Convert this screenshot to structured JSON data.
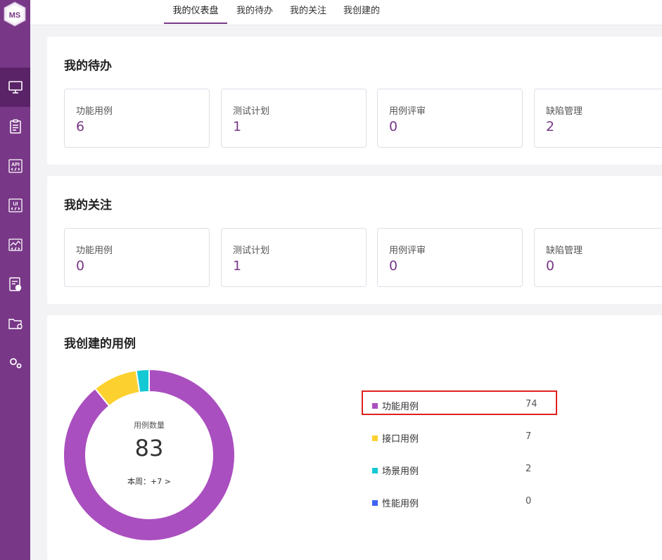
{
  "app": {
    "logo_text": "MS"
  },
  "tabs": [
    {
      "label": "我的仪表盘",
      "active": true
    },
    {
      "label": "我的待办",
      "active": false
    },
    {
      "label": "我的关注",
      "active": false
    },
    {
      "label": "我创建的",
      "active": false
    }
  ],
  "sidebar": {
    "items": [
      {
        "icon": "monitor-icon",
        "active": true
      },
      {
        "icon": "clipboard-icon",
        "active": false
      },
      {
        "icon": "api-icon",
        "text": "API",
        "active": false
      },
      {
        "icon": "ui-icon",
        "text": "UI",
        "active": false
      },
      {
        "icon": "performance-icon",
        "active": false
      },
      {
        "icon": "report-icon",
        "active": false
      },
      {
        "icon": "folder-settings-icon",
        "active": false
      },
      {
        "icon": "gears-icon",
        "active": false
      }
    ]
  },
  "todo": {
    "title": "我的待办",
    "stats": [
      {
        "label": "功能用例",
        "value": "6"
      },
      {
        "label": "测试计划",
        "value": "1"
      },
      {
        "label": "用例评审",
        "value": "0"
      },
      {
        "label": "缺陷管理",
        "value": "2"
      }
    ]
  },
  "follow": {
    "title": "我的关注",
    "stats": [
      {
        "label": "功能用例",
        "value": "0"
      },
      {
        "label": "测试计划",
        "value": "1"
      },
      {
        "label": "用例评审",
        "value": "0"
      },
      {
        "label": "缺陷管理",
        "value": "0"
      }
    ]
  },
  "created": {
    "title": "我创建的用例",
    "center_label": "用例数量",
    "total": "83",
    "week_text": "本周：+7 >"
  },
  "chart_data": {
    "type": "pie",
    "categories": [
      "功能用例",
      "接口用例",
      "场景用例",
      "性能用例"
    ],
    "values": [
      74,
      7,
      2,
      0
    ],
    "colors": [
      "#aa4fbf",
      "#fcd12f",
      "#14c8d4",
      "#3e63f5"
    ]
  }
}
